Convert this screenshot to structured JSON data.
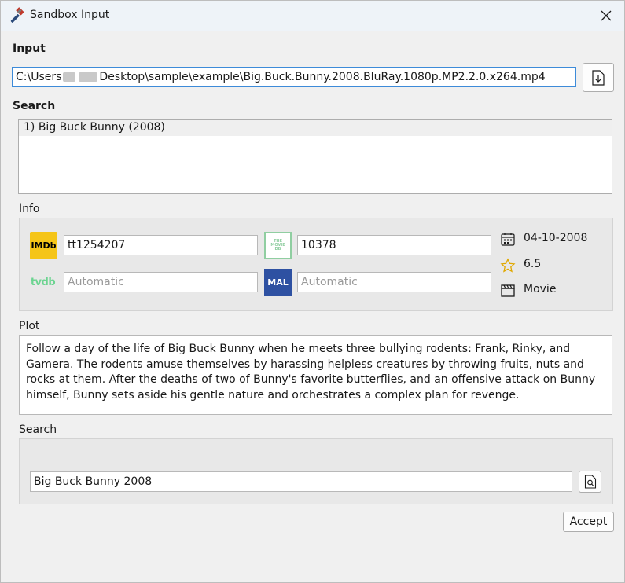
{
  "window": {
    "title": "Sandbox Input"
  },
  "input": {
    "label": "Input",
    "path_prefix": "C:\\Users",
    "path_suffix": "Desktop\\sample\\example\\Big.Buck.Bunny.2008.BluRay.1080p.MP2.2.0.x264.mp4"
  },
  "results": {
    "label": "Search",
    "items": [
      "1) Big Buck Bunny (2008)"
    ]
  },
  "info": {
    "label": "Info",
    "imdb": {
      "logo_text": "IMDb",
      "value": "tt1254207"
    },
    "tmdb": {
      "logo_text": "THE MOVIE DB",
      "value": "10378"
    },
    "tvdb": {
      "logo_text": "tvdb",
      "placeholder": "Automatic"
    },
    "mal": {
      "logo_text": "MAL",
      "placeholder": "Automatic"
    },
    "date": "04-10-2008",
    "rating": "6.5",
    "type": "Movie"
  },
  "plot": {
    "label": "Plot",
    "text": "Follow a day of the life of Big Buck Bunny when he meets three bullying rodents: Frank, Rinky, and Gamera. The rodents amuse themselves by harassing helpless creatures by throwing fruits, nuts and rocks at them. After the deaths of two of Bunny's favorite butterflies, and an offensive attack on Bunny himself, Bunny sets aside his gentle nature and orchestrates a complex plan for revenge."
  },
  "search": {
    "label": "Search",
    "query": "Big Buck Bunny 2008"
  },
  "actions": {
    "accept": "Accept"
  },
  "colors": {
    "imdb": "#f5c518",
    "tmdb": "#90cea1",
    "tvdb": "#6cd491",
    "mal": "#2e51a2",
    "focus": "#3d8bd9"
  }
}
